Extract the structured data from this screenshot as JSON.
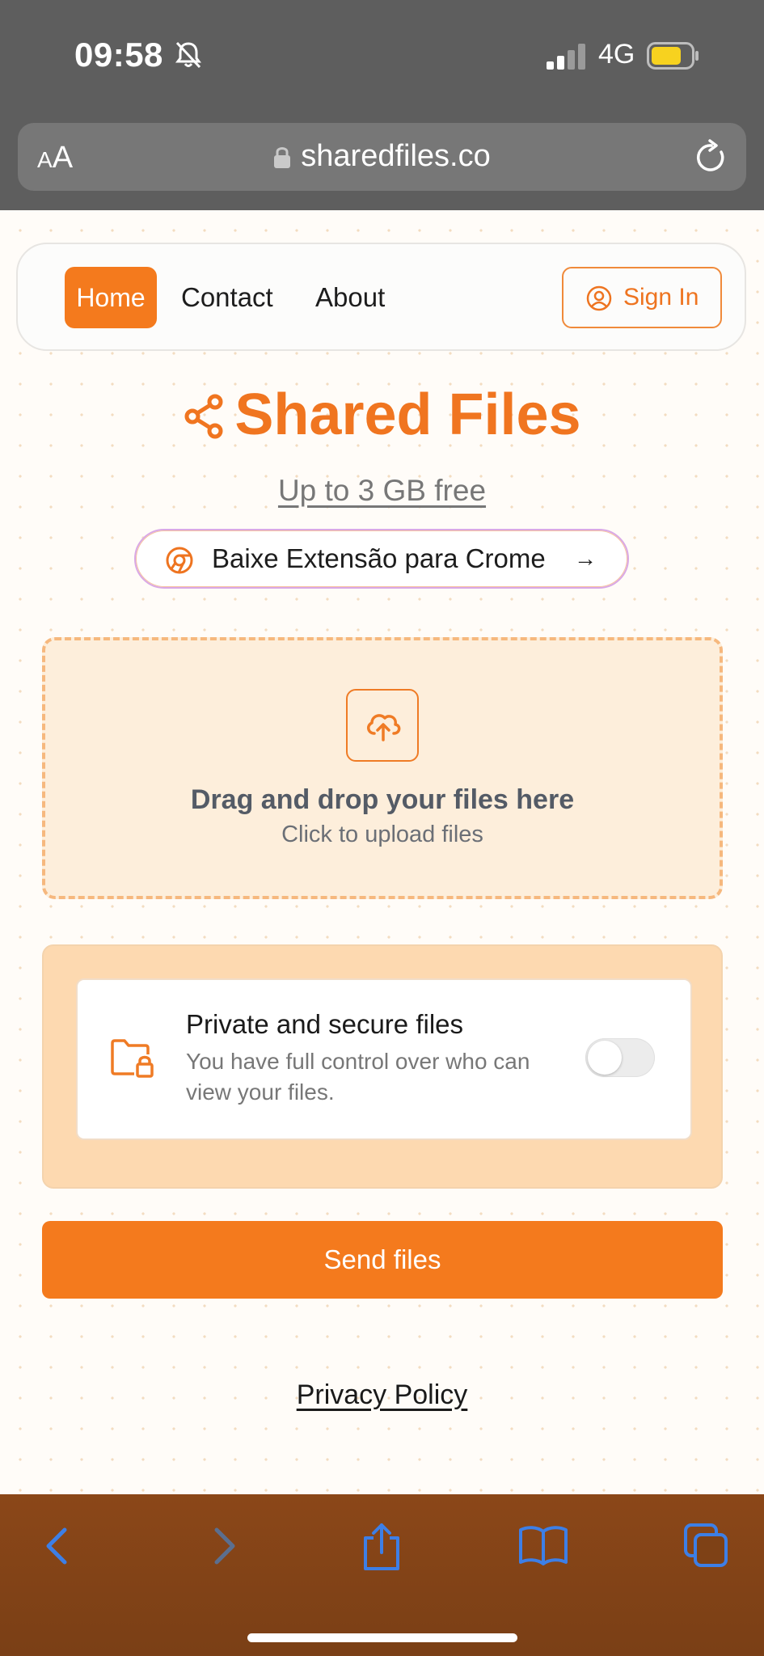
{
  "status_bar": {
    "time": "09:58",
    "network": "4G",
    "icons": [
      "bell-slash-icon",
      "signal-icon",
      "battery-icon"
    ]
  },
  "url_bar": {
    "text_size_label_small": "A",
    "text_size_label_large": "A",
    "url": "sharedfiles.co"
  },
  "navbar": {
    "home": "Home",
    "contact": "Contact",
    "about": "About",
    "sign_in": "Sign In"
  },
  "hero": {
    "title": "Shared Files",
    "subtitle": "Up to 3 GB free",
    "extension_button": "Baixe Extensão para Crome",
    "extension_arrow": "→"
  },
  "dropzone": {
    "title": "Drag and drop your files here",
    "subtitle": "Click to upload files"
  },
  "privacy_option": {
    "title": "Private and secure files",
    "description": "You have full control over who can view your files.",
    "enabled": false
  },
  "actions": {
    "send": "Send files",
    "privacy_policy": "Privacy Policy"
  },
  "colors": {
    "brand_orange": "#f47a1d",
    "toolbar_brown": "#7e4116",
    "toolbar_icon_blue": "#3d7fe6"
  }
}
